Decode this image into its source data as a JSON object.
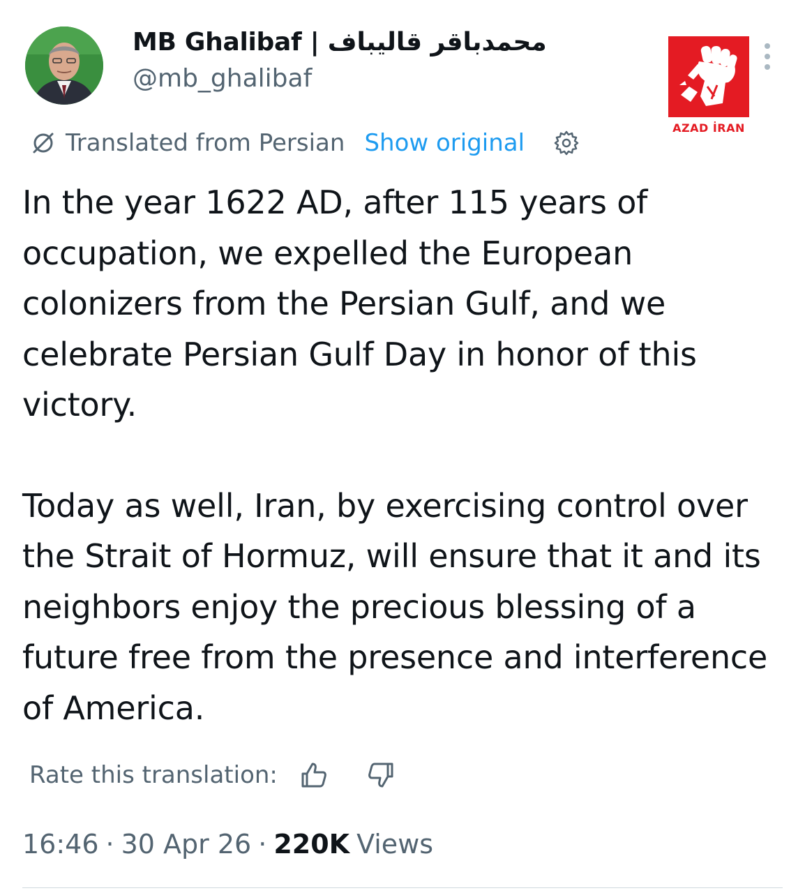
{
  "header": {
    "display_name": "MB Ghalibaf | محمدباقر قالیباف",
    "handle": "@mb_ghalibaf"
  },
  "watermark": {
    "text": "AZAD İRAN",
    "color": "#e41b23"
  },
  "translation": {
    "label": "Translated from Persian",
    "show_original": "Show original",
    "icon": "translate-icon",
    "settings_icon": "gear-icon"
  },
  "tweet": {
    "paragraph_1": "In the year 1622 AD, after 115 years of occupation, we expelled the European colonizers from the Persian Gulf, and we celebrate Persian Gulf Day in honor of this victory.",
    "paragraph_2": "Today as well, Iran, by exercising control over the Strait of Hormuz, will ensure that it and its neighbors enjoy the precious blessing of a future free from the presence and interference of America."
  },
  "rating": {
    "label": "Rate this translation:"
  },
  "meta": {
    "time": "16:46",
    "date": "30 Apr 26",
    "views_count": "220K",
    "views_label": "Views"
  },
  "colors": {
    "text": "#0f1419",
    "secondary": "#536471",
    "link": "#1d9bf0"
  }
}
